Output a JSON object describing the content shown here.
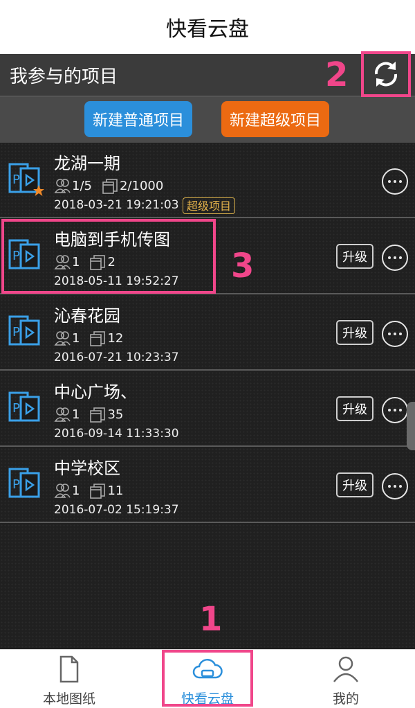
{
  "app": {
    "title": "快看云盘"
  },
  "header": {
    "title": "我参与的项目"
  },
  "actions": {
    "new_normal": "新建普通项目",
    "new_super": "新建超级项目"
  },
  "colors": {
    "accent_blue": "#2b8fdb",
    "accent_orange": "#ec6a12",
    "annotation_pink": "#f0468a",
    "super_gold": "#e4b24a"
  },
  "annotations": {
    "one": "1",
    "two": "2",
    "three": "3"
  },
  "projects": [
    {
      "name": "龙湖一期",
      "members": "1/5",
      "files": "2/1000",
      "date": "2018-03-21 19:21:03",
      "tag": "超级项目",
      "starred": true
    },
    {
      "name": "电脑到手机传图",
      "members": "1",
      "files": "2",
      "date": "2018-05-11 19:52:27",
      "upgrade": "升级"
    },
    {
      "name": "沁春花园",
      "members": "1",
      "files": "12",
      "date": "2016-07-21 10:23:37",
      "upgrade": "升级"
    },
    {
      "name": "中心广场、",
      "members": "1",
      "files": "35",
      "date": "2016-09-14 11:33:30",
      "upgrade": "升级"
    },
    {
      "name": "中学校区",
      "members": "1",
      "files": "11",
      "date": "2016-07-02 15:19:37",
      "upgrade": "升级"
    }
  ],
  "tabs": [
    {
      "label": "本地图纸",
      "icon": "file-icon"
    },
    {
      "label": "快看云盘",
      "icon": "cloud-icon",
      "active": true
    },
    {
      "label": "我的",
      "icon": "user-icon"
    }
  ]
}
